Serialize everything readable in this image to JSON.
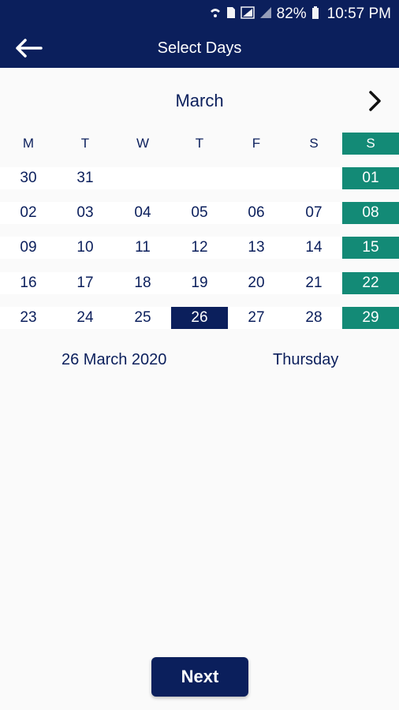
{
  "status_bar": {
    "icons": [
      "wifi-icon",
      "sim-icon",
      "signal-icon",
      "signal-icon",
      "battery-icon"
    ],
    "battery": "82%",
    "time": "10:57 PM"
  },
  "app_bar": {
    "title": "Select Days"
  },
  "calendar": {
    "month": "March",
    "weekdays": [
      "M",
      "T",
      "W",
      "T",
      "F",
      "S",
      "S"
    ],
    "weeks": [
      [
        "30",
        "31",
        "",
        "",
        "",
        "",
        "01"
      ],
      [
        "02",
        "03",
        "04",
        "05",
        "06",
        "07",
        "08"
      ],
      [
        "09",
        "10",
        "11",
        "12",
        "13",
        "14",
        "15"
      ],
      [
        "16",
        "17",
        "18",
        "19",
        "20",
        "21",
        "22"
      ],
      [
        "23",
        "24",
        "25",
        "26",
        "27",
        "28",
        "29"
      ]
    ],
    "selected_day": "26"
  },
  "selection": {
    "date": "26 March 2020",
    "weekday": "Thursday"
  },
  "footer": {
    "next_label": "Next"
  },
  "colors": {
    "primary": "#0b1f5c",
    "sunday": "#138a76",
    "background": "#fafafa"
  }
}
